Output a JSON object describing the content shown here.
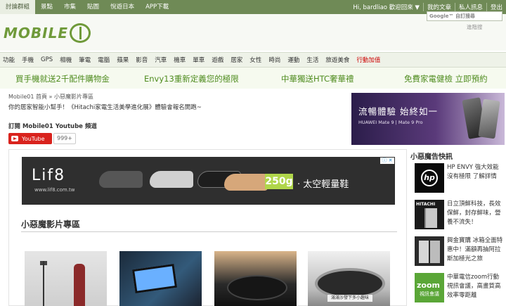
{
  "topbar": {
    "tabs": [
      "討論群組",
      "景點",
      "市集",
      "貼圖",
      "悅遊日本",
      "APP下載"
    ],
    "greeting": "Hi, bardliao 歡迎回來 ▼",
    "links": [
      "我的文章",
      "私人訊息",
      "登出"
    ]
  },
  "header": {
    "logo_text": "MOBILE",
    "search_placeholder": "Google™ 自訂搜尋",
    "advanced_search": "進階搜"
  },
  "catnav": {
    "items": [
      "功能",
      "手機",
      "GPS",
      "相機",
      "筆電",
      "電腦",
      "蘋果",
      "影音",
      "汽車",
      "機車",
      "單車",
      "遊戲",
      "居家",
      "女性",
      "時尚",
      "運動",
      "生活",
      "旅遊美食",
      "行動加值"
    ]
  },
  "promos": [
    "買手機就送2千配件購物金",
    "Envy13重新定義您的極限",
    "中華獨送HTC奢華禮",
    "免費家電健檢 立即預約"
  ],
  "breadcrumb": "Mobile01 首頁 » 小惡魔影片專區",
  "intro": "你的居家智能小幫手！《Hitachi家電生活美學進化展》體驗會報名開跑~",
  "subscribe": {
    "title": "訂閱 Mobile01 Youtube 頻道",
    "button": "YouTube",
    "count": "999+"
  },
  "huawei_ad": {
    "headline": "流暢體驗 始終如一",
    "sub": "HUAWEI Mate 9 | Mate 9 Pro"
  },
  "ad_banner": {
    "brand": "Lif8",
    "url": "www.lif8.com.tw",
    "weight": "250g",
    "slogan": "· 太空輕量鞋"
  },
  "section_title": "小惡魔影片專區",
  "video_caption": "滿滿沙發下多小趣味",
  "sidebar": {
    "title": "小惡魔告快訊",
    "items": [
      {
        "text": "HP ENVY 強大效能沒有極限 了解詳情",
        "icon": "hp"
      },
      {
        "text": "日立頂鮮科技，長效保鮮，封存鮮味，營養不流失！",
        "icon": "hitachi"
      },
      {
        "text": "興金寶購 冰箱全面特惠中！滿額再抽阿拉斯加極光之旅",
        "icon": "fridge"
      },
      {
        "text": "中華電信zoom行動視訊會議，高畫質高效率零距離",
        "icon": "zoom"
      }
    ],
    "hitachi_brand": "HITACHI",
    "zoom_word": "zoom",
    "zoom_sub": "視訊會議"
  }
}
